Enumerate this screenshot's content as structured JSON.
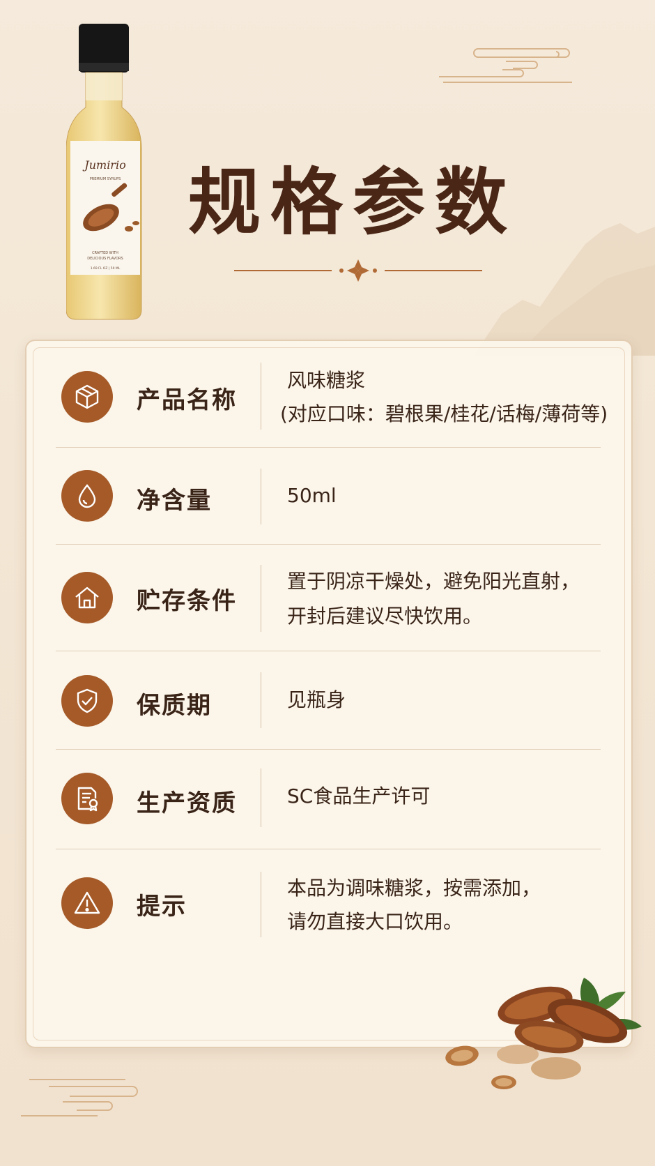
{
  "header": {
    "title": "规格参数",
    "bottle_label": {
      "brand": "Jumirio",
      "line1": "PREMIUM SYRUPS",
      "line2": "CRAFTED WITH",
      "line3": "DELICIOUS FLAVORS",
      "volume": "1.69 FL OZ | 50 ML"
    }
  },
  "specs": [
    {
      "icon": "box-icon",
      "label": "产品名称",
      "value_line1": "风味糖浆",
      "value_line2": "(对应口味：碧根果/桂花/话梅/薄荷等)"
    },
    {
      "icon": "droplet-icon",
      "label": "净含量",
      "value_line1": "50ml",
      "value_line2": ""
    },
    {
      "icon": "house-icon",
      "label": "贮存条件",
      "value_line1": "置于阴凉干燥处，避免阳光直射，",
      "value_line2": "开封后建议尽快饮用。"
    },
    {
      "icon": "shield-check-icon",
      "label": "保质期",
      "value_line1": "见瓶身",
      "value_line2": ""
    },
    {
      "icon": "certificate-icon",
      "label": "生产资质",
      "value_line1": "SC食品生产许可",
      "value_line2": ""
    },
    {
      "icon": "warning-icon",
      "label": "提示",
      "value_line1": "本品为调味糖浆，按需添加，",
      "value_line2": "请勿直接大口饮用。"
    }
  ],
  "colors": {
    "accent": "#a55a28",
    "title": "#4a2616",
    "background": "#f3e6d4",
    "card": "#fcf6ec"
  }
}
